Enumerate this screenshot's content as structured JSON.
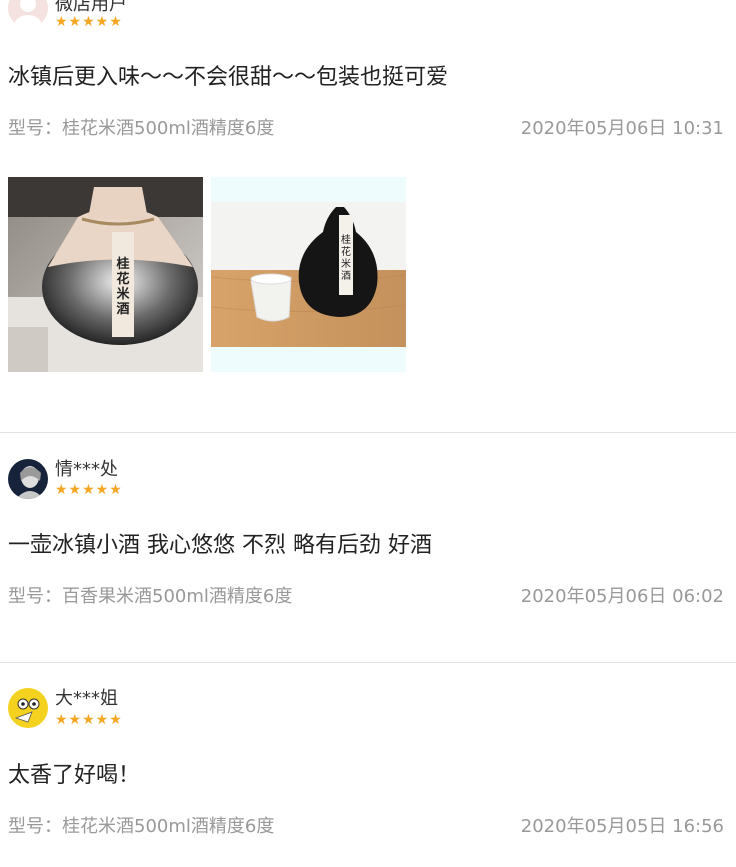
{
  "reviews": [
    {
      "username": "微店用户",
      "stars": "★★★★★",
      "content": "冰镇后更入味～～不会很甜～～包装也挺可爱",
      "model": "型号：桂花米酒500ml酒精度6度",
      "date": "2020年05月06日 10:31",
      "photo1_label": "桂花米酒",
      "photo2_label": "桂花米酒"
    },
    {
      "username": "情***处",
      "stars": "★★★★★",
      "content": "一壶冰镇小酒 我心悠悠 不烈 略有后劲 好酒",
      "model": "型号：百香果米酒500ml酒精度6度",
      "date": "2020年05月06日 06:02"
    },
    {
      "username": "大***姐",
      "stars": "★★★★★",
      "content": "太香了好喝！",
      "model": "型号：桂花米酒500ml酒精度6度",
      "date": "2020年05月05日 16:56"
    }
  ],
  "colors": {
    "star": "#f5a623",
    "meta_text": "#999999",
    "divider": "#e2e2e2"
  }
}
